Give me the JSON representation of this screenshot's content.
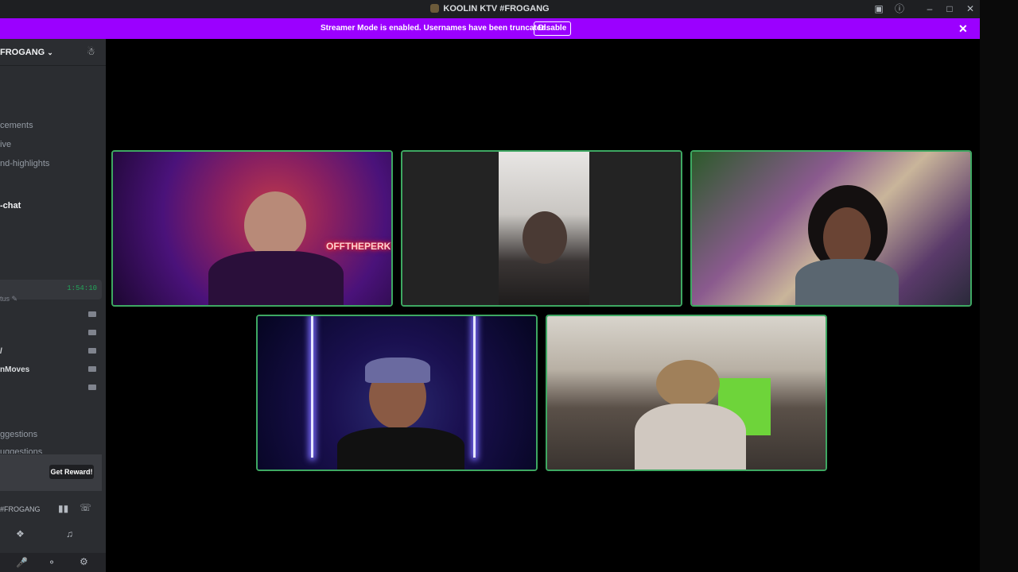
{
  "window": {
    "title": "KOOLIN KTV #FROGANG",
    "controls": [
      "screen-share-icon",
      "help-icon",
      "minimize-icon",
      "maximize-icon",
      "close-icon"
    ]
  },
  "banner": {
    "message": "Streamer Mode is enabled. Usernames have been truncated.",
    "disable_label": "Disable",
    "color": "#9b00ff"
  },
  "sidebar": {
    "server_name": "FROGANG",
    "channels": [
      {
        "label": "cements",
        "active": false
      },
      {
        "label": "ive",
        "active": false
      },
      {
        "label": "nd-highlights",
        "active": false
      },
      {
        "label": "-chat",
        "active": true
      }
    ],
    "voice_timer": "1:54:10",
    "status_label": "tus",
    "voice_users": [
      "",
      "",
      "/",
      "nMoves",
      ""
    ],
    "suggestion_channels": [
      "ggestions",
      "uggestions"
    ],
    "reward_label": "Get Reward!",
    "voice_connected_label": "#FROGANG"
  },
  "participants": [
    {
      "id": "p1",
      "neon_text": "OFFTHEPERKY"
    },
    {
      "id": "p2"
    },
    {
      "id": "p3"
    },
    {
      "id": "p4"
    },
    {
      "id": "p5"
    }
  ],
  "colors": {
    "speaking_border": "#3ea862",
    "sidebar_bg": "#2b2d31",
    "titlebar_bg": "#1e1f22",
    "timer_green": "#23a55a"
  }
}
